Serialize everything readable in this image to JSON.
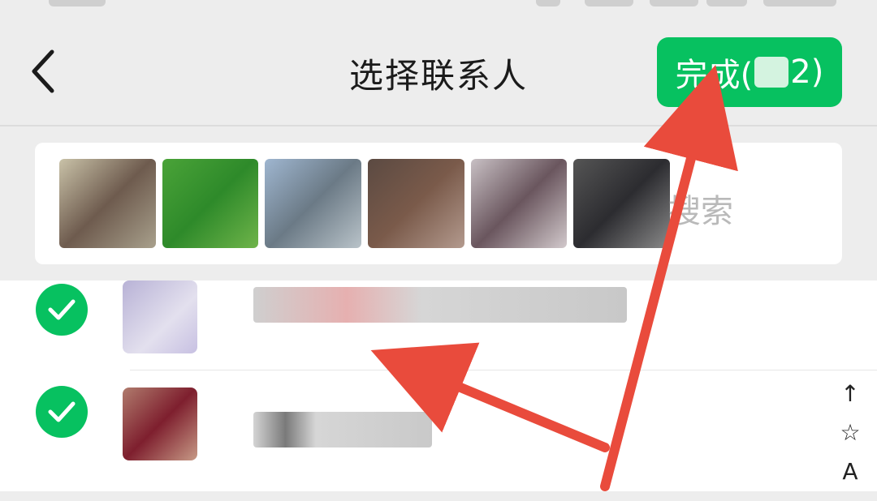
{
  "header": {
    "title": "选择联系人",
    "done_label": "完成(",
    "done_label_end": "2)"
  },
  "search": {
    "placeholder": "搜索"
  },
  "index_bar": [
    "↑",
    "☆",
    "A"
  ],
  "colors": {
    "accent": "#07c160",
    "background": "#ededed",
    "annotation": "#e94b3c"
  }
}
